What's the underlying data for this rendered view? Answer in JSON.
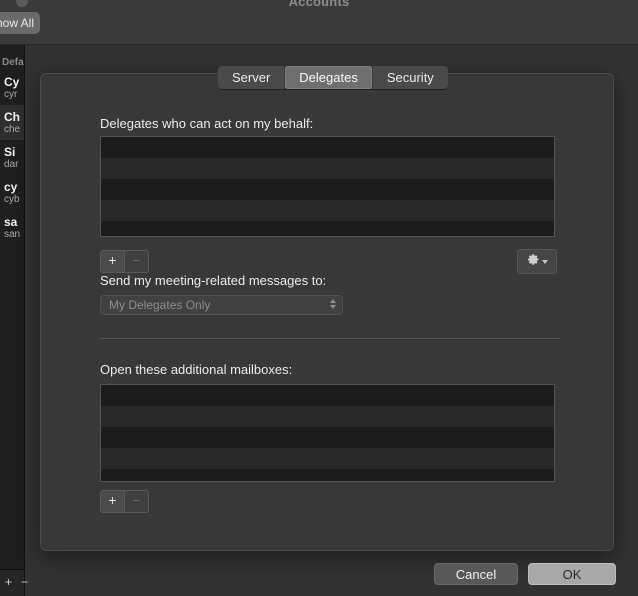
{
  "window": {
    "title": "Accounts",
    "show_all_label": "Show All"
  },
  "sidebar": {
    "section_label": "Default",
    "items": [
      {
        "name": "Cy",
        "sub": "cyr",
        "selected": false
      },
      {
        "name": "Ch",
        "sub": "che",
        "selected": true
      },
      {
        "name": "Si",
        "sub": "dar",
        "selected": false
      },
      {
        "name": "cy",
        "sub": "cyb",
        "selected": false
      },
      {
        "name": "sa",
        "sub": "san",
        "selected": false
      }
    ],
    "footer": {
      "add_label": "+",
      "remove_label": "−"
    }
  },
  "tabs": [
    {
      "label": "Server",
      "active": false
    },
    {
      "label": "Delegates",
      "active": true
    },
    {
      "label": "Security",
      "active": false
    }
  ],
  "delegates": {
    "list_label": "Delegates who can act on my behalf:",
    "list_items": [],
    "add_label": "+",
    "remove_label": "−",
    "gear_icon": "gear-icon",
    "meeting_label": "Send my meeting-related messages to:",
    "meeting_value": "My Delegates Only"
  },
  "mailboxes": {
    "list_label": "Open these additional mailboxes:",
    "list_items": [],
    "add_label": "+",
    "remove_label": "−"
  },
  "actions": {
    "cancel_label": "Cancel",
    "ok_label": "OK"
  },
  "colors": {
    "window_bg": "#323232",
    "sheet_bg": "#383838",
    "list_bg": "#1c1c1c",
    "list_stripe": "#282828",
    "tab_active": "#6e6e6e",
    "default_button": "#a8a8a8"
  }
}
